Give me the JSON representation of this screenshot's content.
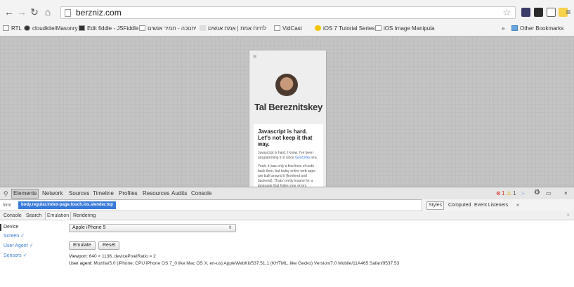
{
  "browser": {
    "url": "berzniz.com",
    "bookmarks": [
      "RTL",
      "cloudkite/Masonry",
      "Edit fiddle - JSFiddle",
      "יחנוכה - תמיר אנשים",
      "לחיות אמת | אמת אנשים",
      "VidCast",
      "iOS 7 Tutorial Series",
      "iOS Image Manipula",
      "»",
      "Other Bookmarks"
    ]
  },
  "page": {
    "menu_glyph": "≡",
    "name": "Tal Bereznitskey",
    "card_title": "Javascript is hard. Let's not keep it that way.",
    "card_text_1": "Javascript is hard. I know. I've been programming in it since",
    "card_text_link": "GeoCities",
    "card_text_1b": "era.",
    "card_text_2": "Yeah, it was only a few lines of code back then, but today entire web apps are built around it (frontend and backend). Thats' pretty insane for a language that hides your errors"
  },
  "devtools": {
    "tabs": [
      "Elements",
      "Network",
      "Sources",
      "Timeline",
      "Profiles",
      "Resources",
      "Audits",
      "Console"
    ],
    "active_tab": "Elements",
    "status_errors": "1",
    "status_warnings": "1",
    "breadcrumb_html": "html",
    "breadcrumb_selected": "body.regular.index-page.touch.ios.slender.top",
    "side_tabs": [
      "Styles",
      "Computed",
      "Event Listeners",
      "»"
    ],
    "drawer_tabs": [
      "Console",
      "Search",
      "Emulation",
      "Rendering"
    ],
    "emulation_sidebar": [
      "Device",
      "Screen ✓",
      "User Agent ✓",
      "Sensors ✓"
    ],
    "device_value": "Apple iPhone 5",
    "emulate_label": "Emulate",
    "reset_label": "Reset",
    "viewport_label": "Viewport:",
    "viewport_value": "640 × 1136, devicePixelRatio = 2",
    "useragent_label": "User agent:",
    "useragent_value": "Mozilla/5.0 (iPhone; CPU iPhone OS 7_0 like Mac OS X; en-us) AppleWebKit/537.51.1 (KHTML, like Gecko) Version/7.0 Mobile/11A465 Safari/9537.53"
  },
  "colors": {
    "accent_blue": "#3879d9",
    "error_red": "#d93025",
    "warning_yellow": "#e8a500"
  }
}
